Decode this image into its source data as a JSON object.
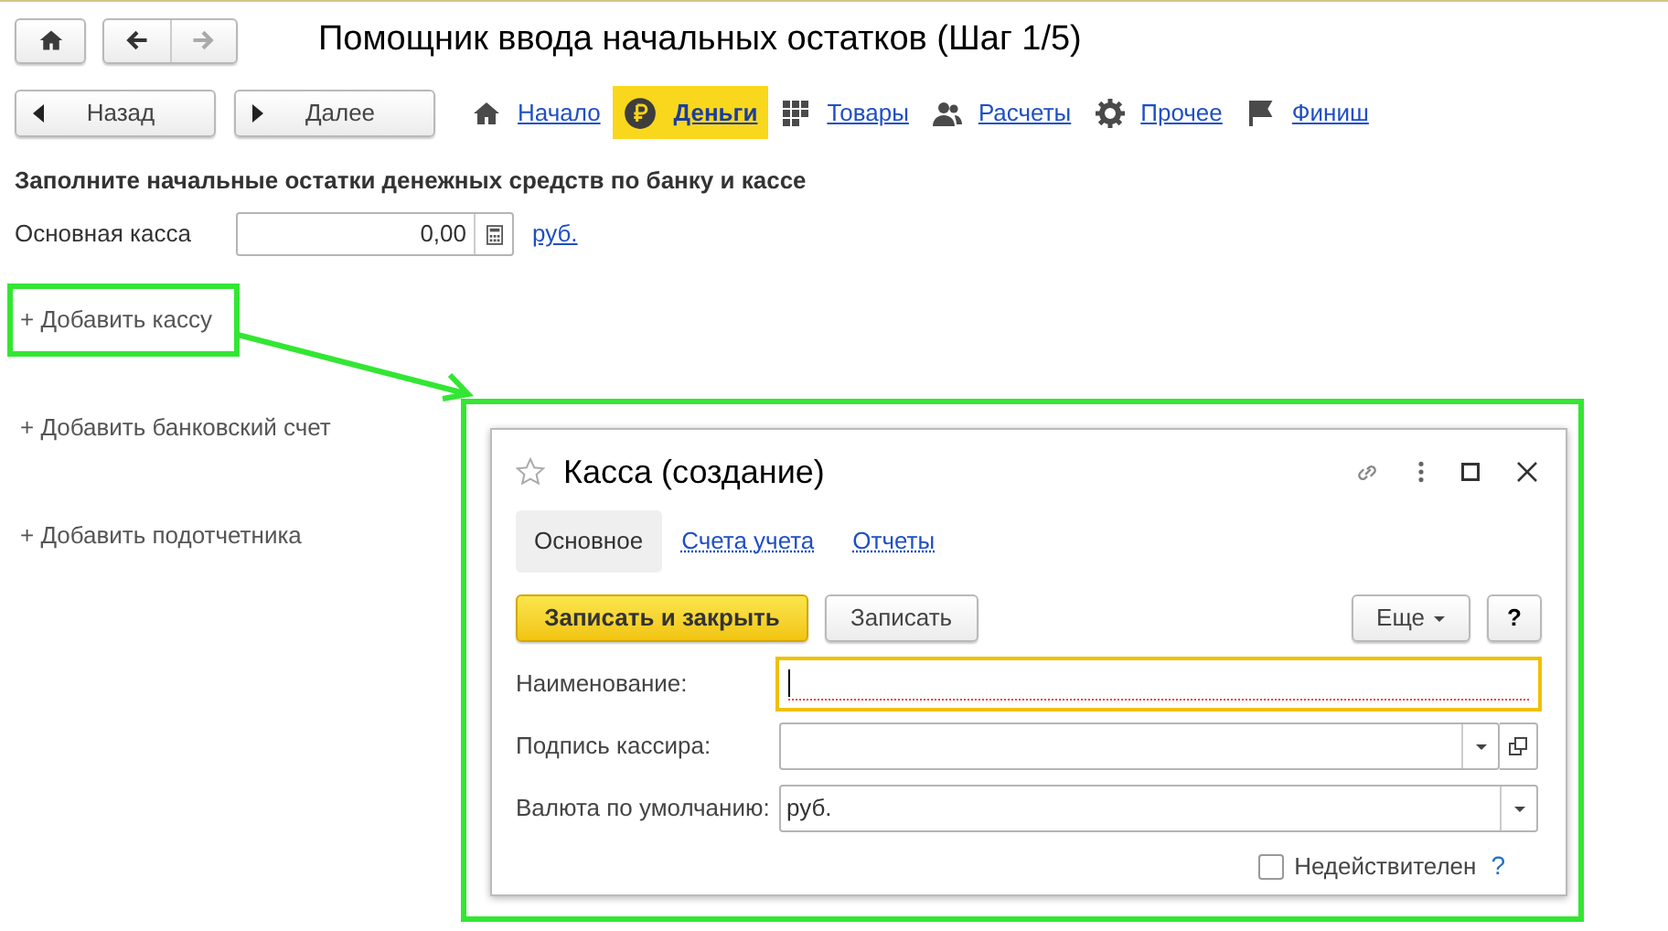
{
  "window": {
    "title": "Помощник ввода начальных остатков (Шаг 1/5)"
  },
  "wizard_buttons": [
    "Назад",
    "Далее"
  ],
  "steps": [
    {
      "label": "Начало",
      "selected": false
    },
    {
      "label": "Деньги",
      "selected": true
    },
    {
      "label": "Товары",
      "selected": false
    },
    {
      "label": "Расчеты",
      "selected": false
    },
    {
      "label": "Прочее",
      "selected": false
    },
    {
      "label": "Финиш",
      "selected": false
    }
  ],
  "heading": "Заполните начальные остатки денежных средств по банку и кассе",
  "cash_row": {
    "label": "Основная касса",
    "value": "0,00",
    "currency": "руб."
  },
  "add_links": [
    {
      "label": "+ Добавить кассу",
      "highlighted": true
    },
    {
      "label": "+ Добавить банковский счет",
      "highlighted": false
    },
    {
      "label": "+ Добавить подотчетника",
      "highlighted": false
    }
  ],
  "dialog": {
    "title": "Касса (создание)",
    "tabs": [
      {
        "label": "Основное",
        "selected": true
      },
      {
        "label": "Счета учета",
        "selected": false
      },
      {
        "label": "Отчеты",
        "selected": false
      }
    ],
    "buttons": [
      {
        "label": "Записать и закрыть",
        "kind": "primary"
      },
      {
        "label": "Записать",
        "kind": "normal"
      }
    ],
    "more": "Еще",
    "help": "?",
    "fields": [
      {
        "label": "Наименование:",
        "kind": "text",
        "focused": true
      },
      {
        "label": "Подпись кассира:",
        "kind": "select_open"
      },
      {
        "label": "Валюта по умолчанию:",
        "kind": "select",
        "value": "руб."
      }
    ],
    "inactive": {
      "label": "Недействителен",
      "checked": false,
      "help": "?"
    }
  }
}
